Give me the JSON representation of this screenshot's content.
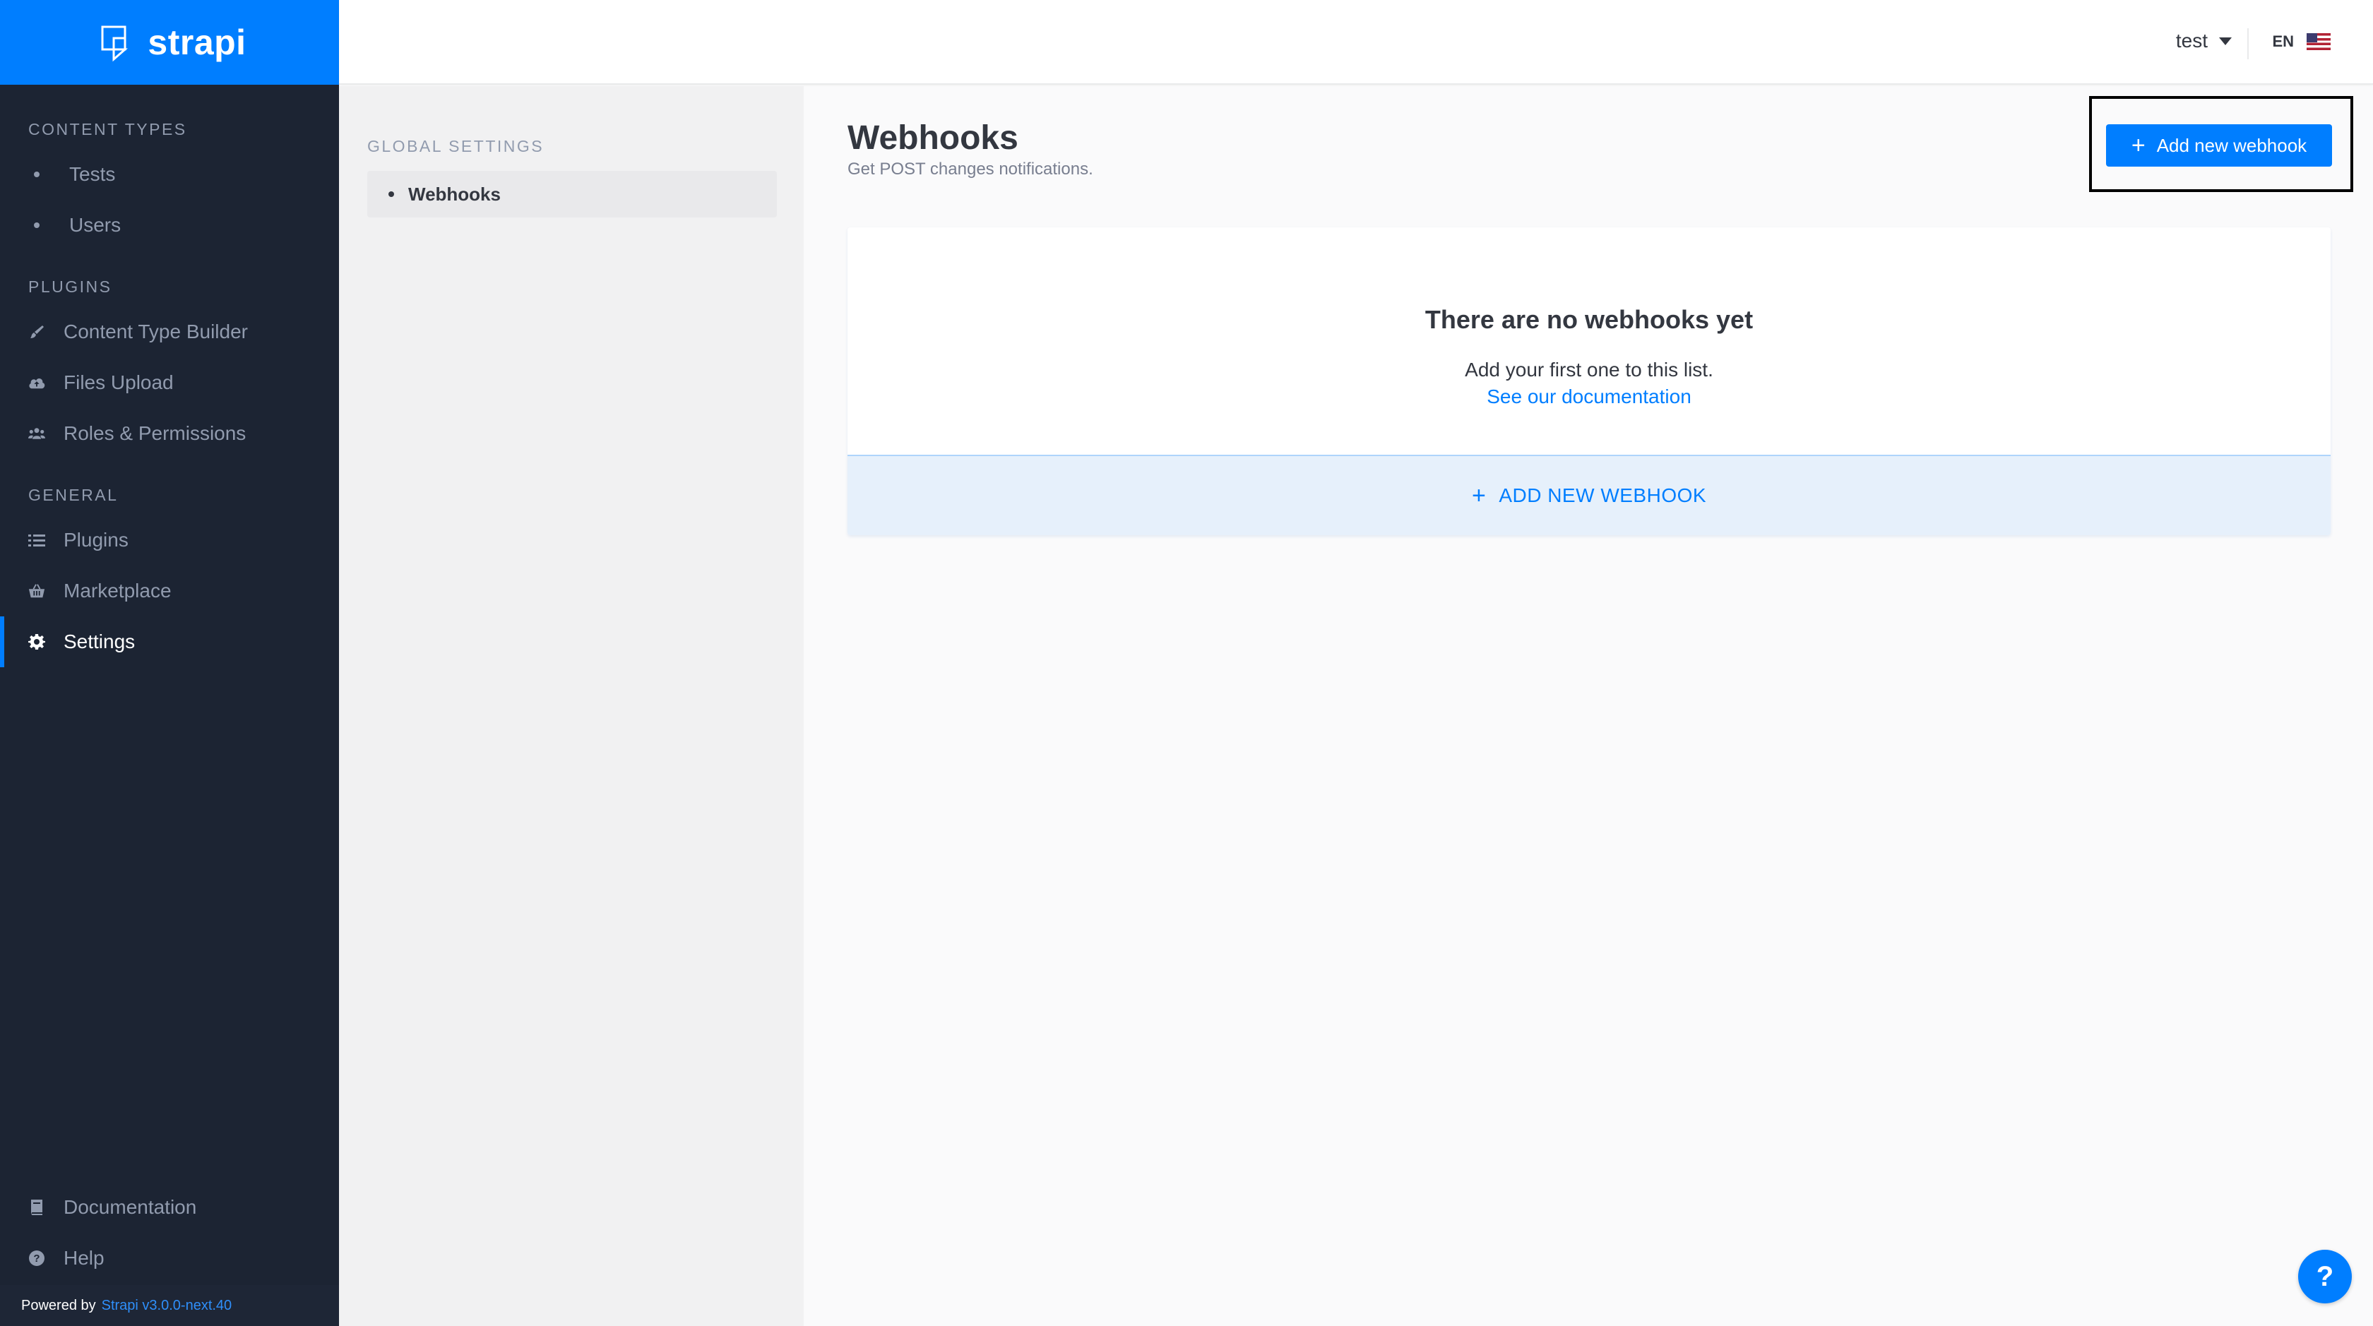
{
  "brand": {
    "name": "strapi"
  },
  "sidebar": {
    "content_types": {
      "title": "CONTENT TYPES",
      "items": [
        {
          "label": "Tests"
        },
        {
          "label": "Users"
        }
      ]
    },
    "plugins": {
      "title": "PLUGINS",
      "items": [
        {
          "label": "Content Type Builder",
          "icon": "paint-brush-icon"
        },
        {
          "label": "Files Upload",
          "icon": "cloud-upload-icon"
        },
        {
          "label": "Roles & Permissions",
          "icon": "users-icon"
        }
      ]
    },
    "general": {
      "title": "GENERAL",
      "items": [
        {
          "label": "Plugins",
          "icon": "list-icon"
        },
        {
          "label": "Marketplace",
          "icon": "basket-icon"
        },
        {
          "label": "Settings",
          "icon": "gear-icon",
          "active": true
        }
      ]
    },
    "bottom": {
      "items": [
        {
          "label": "Documentation",
          "icon": "book-icon"
        },
        {
          "label": "Help",
          "icon": "question-circle-icon"
        }
      ]
    },
    "powered_by": {
      "prefix": "Powered by",
      "version_link": "Strapi v3.0.0-next.40"
    }
  },
  "header": {
    "user": "test",
    "language": "EN"
  },
  "subnav": {
    "section_title": "GLOBAL SETTINGS",
    "items": [
      {
        "label": "Webhooks",
        "active": true
      }
    ]
  },
  "main": {
    "title": "Webhooks",
    "description": "Get POST changes notifications.",
    "add_button_label": "Add new webhook",
    "empty": {
      "title": "There are no webhooks yet",
      "text": "Add your first one to this list.",
      "link": "See our documentation",
      "footer_label": "ADD NEW WEBHOOK"
    }
  },
  "help_fab": {
    "label": "?"
  },
  "colors": {
    "accent": "#007eff",
    "sidebar": "#1c2433"
  }
}
